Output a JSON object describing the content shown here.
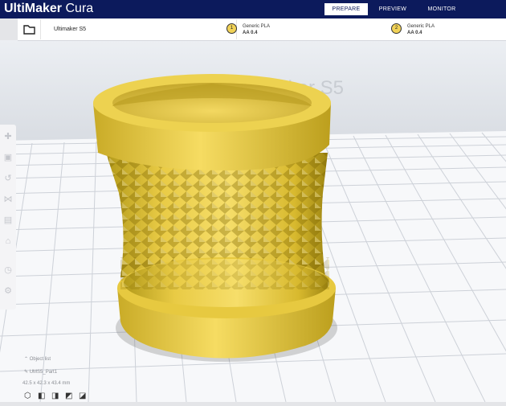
{
  "app": {
    "brand_bold": "UltiMaker",
    "brand_light": "Cura"
  },
  "nav": {
    "prepare": "PREPARE",
    "preview": "PREVIEW",
    "monitor": "MONITOR",
    "active": "prepare"
  },
  "toolbar": {
    "printer_name": "Ultimaker S5",
    "extruders": [
      {
        "index": "1",
        "material": "Generic PLA",
        "nozzle": "AA 0.4"
      },
      {
        "index": "2",
        "material": "Generic PLA",
        "nozzle": "AA 0.4"
      }
    ]
  },
  "viewport": {
    "buildplate_label": "Ultimaker S5",
    "model_color": "#f1d257"
  },
  "object_info": {
    "list_label": "Object list",
    "filename": "UMS5_Part1",
    "dimensions": "42.5 x 42.3 x 43.4 mm"
  },
  "colors": {
    "topbar": "#0c1a5c",
    "accent_yellow": "#f1d257"
  }
}
